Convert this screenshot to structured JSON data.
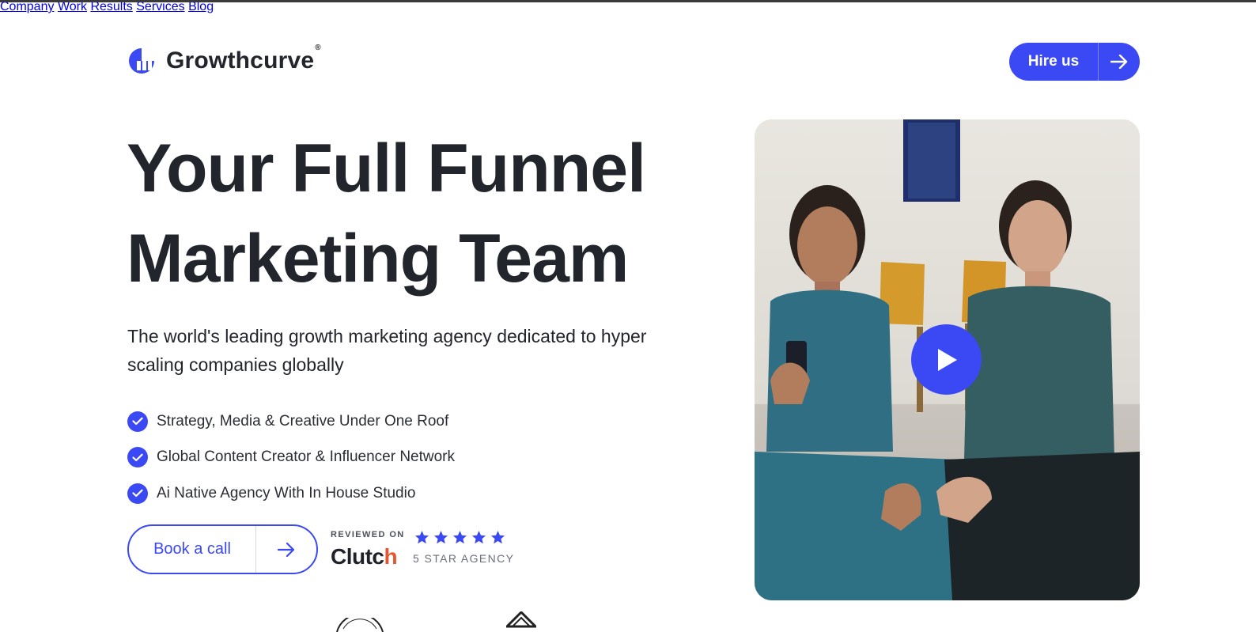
{
  "brand": {
    "name": "Growthcurve",
    "reg_mark": "®",
    "accent": "#3b49f5"
  },
  "nav": {
    "items": [
      {
        "label": "Company"
      },
      {
        "label": "Work"
      },
      {
        "label": "Results"
      },
      {
        "label": "Services"
      },
      {
        "label": "Blog"
      }
    ],
    "cta_label": "Hire us",
    "cta_icon": "arrow-right-icon"
  },
  "hero": {
    "headline_line1": "Your Full Funnel",
    "headline_line2": "Marketing Team",
    "subtitle": "The world's leading growth marketing agency dedicated to hyper scaling companies globally",
    "features": [
      "Strategy, Media & Creative Under One Roof",
      "Global Content Creator & Influencer Network",
      "Ai Native Agency With In House Studio"
    ],
    "feature_icon": "check-circle-icon",
    "book_label": "Book a call",
    "book_icon": "arrow-right-icon"
  },
  "clutch": {
    "reviewed_on": "REVIEWED ON",
    "brand_text": "Clutch",
    "rating_stars": 5,
    "agency_label": "5 STAR AGENCY"
  },
  "video": {
    "play_icon": "play-icon"
  }
}
